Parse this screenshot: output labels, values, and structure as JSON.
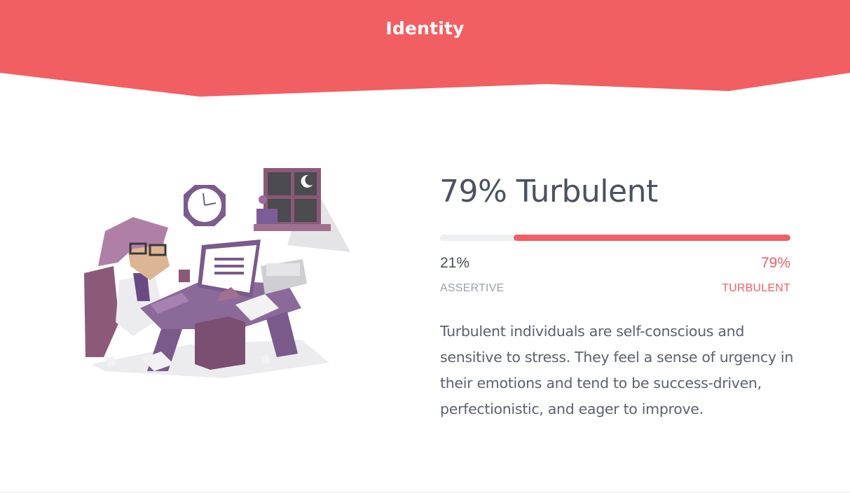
{
  "section": {
    "title": "Identity"
  },
  "trait": {
    "heading": "79% Turbulent",
    "description": "Turbulent individuals are self-conscious and sensitive to stress. They feel a sense of urgency in their emotions and tend to be success-driven, perfectionistic, and eager to improve.",
    "progress_fraction": 0.79,
    "left": {
      "percent": "21%",
      "label": "ASSERTIVE"
    },
    "right": {
      "percent": "79%",
      "label": "TURBULENT"
    }
  },
  "colors": {
    "accent": "#f25f63",
    "text_dark": "#4a5160",
    "text_muted": "#9aa1ad",
    "track": "#eeeff2",
    "illustration_purple": "#8a6a96"
  },
  "illustration": {
    "icon": "turbulent-person-at-desk-illustration"
  }
}
